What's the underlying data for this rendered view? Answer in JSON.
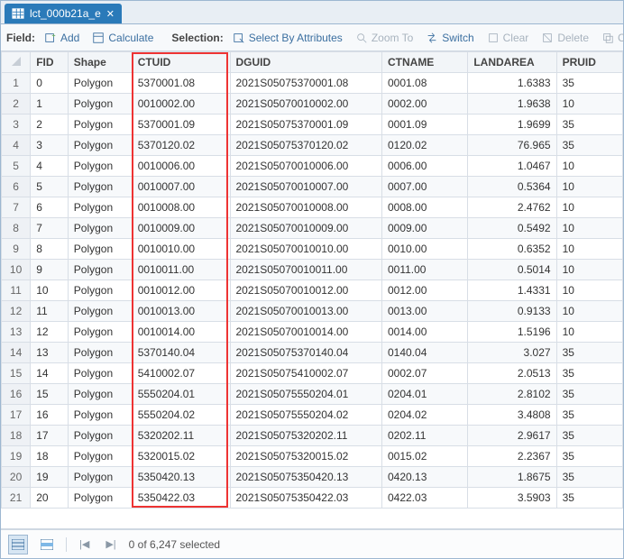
{
  "tab": {
    "title": "lct_000b21a_e",
    "icon": "table-icon"
  },
  "toolbar": {
    "field_label": "Field:",
    "add": "Add",
    "calculate": "Calculate",
    "selection_label": "Selection:",
    "select_by_attrs": "Select By Attributes",
    "zoom_to": "Zoom To",
    "switch": "Switch",
    "clear": "Clear",
    "delete": "Delete",
    "copy": "Copy"
  },
  "columns": [
    "FID",
    "Shape",
    "CTUID",
    "DGUID",
    "CTNAME",
    "LANDAREA",
    "PRUID"
  ],
  "highlight_column": "CTUID",
  "rows": [
    {
      "n": 1,
      "fid": 0,
      "shape": "Polygon",
      "ctuid": "5370001.08",
      "dguid": "2021S05075370001.08",
      "ctname": "0001.08",
      "landarea": "1.6383",
      "pruid": "35"
    },
    {
      "n": 2,
      "fid": 1,
      "shape": "Polygon",
      "ctuid": "0010002.00",
      "dguid": "2021S05070010002.00",
      "ctname": "0002.00",
      "landarea": "1.9638",
      "pruid": "10"
    },
    {
      "n": 3,
      "fid": 2,
      "shape": "Polygon",
      "ctuid": "5370001.09",
      "dguid": "2021S05075370001.09",
      "ctname": "0001.09",
      "landarea": "1.9699",
      "pruid": "35"
    },
    {
      "n": 4,
      "fid": 3,
      "shape": "Polygon",
      "ctuid": "5370120.02",
      "dguid": "2021S05075370120.02",
      "ctname": "0120.02",
      "landarea": "76.965",
      "pruid": "35"
    },
    {
      "n": 5,
      "fid": 4,
      "shape": "Polygon",
      "ctuid": "0010006.00",
      "dguid": "2021S05070010006.00",
      "ctname": "0006.00",
      "landarea": "1.0467",
      "pruid": "10"
    },
    {
      "n": 6,
      "fid": 5,
      "shape": "Polygon",
      "ctuid": "0010007.00",
      "dguid": "2021S05070010007.00",
      "ctname": "0007.00",
      "landarea": "0.5364",
      "pruid": "10"
    },
    {
      "n": 7,
      "fid": 6,
      "shape": "Polygon",
      "ctuid": "0010008.00",
      "dguid": "2021S05070010008.00",
      "ctname": "0008.00",
      "landarea": "2.4762",
      "pruid": "10"
    },
    {
      "n": 8,
      "fid": 7,
      "shape": "Polygon",
      "ctuid": "0010009.00",
      "dguid": "2021S05070010009.00",
      "ctname": "0009.00",
      "landarea": "0.5492",
      "pruid": "10"
    },
    {
      "n": 9,
      "fid": 8,
      "shape": "Polygon",
      "ctuid": "0010010.00",
      "dguid": "2021S05070010010.00",
      "ctname": "0010.00",
      "landarea": "0.6352",
      "pruid": "10"
    },
    {
      "n": 10,
      "fid": 9,
      "shape": "Polygon",
      "ctuid": "0010011.00",
      "dguid": "2021S05070010011.00",
      "ctname": "0011.00",
      "landarea": "0.5014",
      "pruid": "10"
    },
    {
      "n": 11,
      "fid": 10,
      "shape": "Polygon",
      "ctuid": "0010012.00",
      "dguid": "2021S05070010012.00",
      "ctname": "0012.00",
      "landarea": "1.4331",
      "pruid": "10"
    },
    {
      "n": 12,
      "fid": 11,
      "shape": "Polygon",
      "ctuid": "0010013.00",
      "dguid": "2021S05070010013.00",
      "ctname": "0013.00",
      "landarea": "0.9133",
      "pruid": "10"
    },
    {
      "n": 13,
      "fid": 12,
      "shape": "Polygon",
      "ctuid": "0010014.00",
      "dguid": "2021S05070010014.00",
      "ctname": "0014.00",
      "landarea": "1.5196",
      "pruid": "10"
    },
    {
      "n": 14,
      "fid": 13,
      "shape": "Polygon",
      "ctuid": "5370140.04",
      "dguid": "2021S05075370140.04",
      "ctname": "0140.04",
      "landarea": "3.027",
      "pruid": "35"
    },
    {
      "n": 15,
      "fid": 14,
      "shape": "Polygon",
      "ctuid": "5410002.07",
      "dguid": "2021S05075410002.07",
      "ctname": "0002.07",
      "landarea": "2.0513",
      "pruid": "35"
    },
    {
      "n": 16,
      "fid": 15,
      "shape": "Polygon",
      "ctuid": "5550204.01",
      "dguid": "2021S05075550204.01",
      "ctname": "0204.01",
      "landarea": "2.8102",
      "pruid": "35"
    },
    {
      "n": 17,
      "fid": 16,
      "shape": "Polygon",
      "ctuid": "5550204.02",
      "dguid": "2021S05075550204.02",
      "ctname": "0204.02",
      "landarea": "3.4808",
      "pruid": "35"
    },
    {
      "n": 18,
      "fid": 17,
      "shape": "Polygon",
      "ctuid": "5320202.11",
      "dguid": "2021S05075320202.11",
      "ctname": "0202.11",
      "landarea": "2.9617",
      "pruid": "35"
    },
    {
      "n": 19,
      "fid": 18,
      "shape": "Polygon",
      "ctuid": "5320015.02",
      "dguid": "2021S05075320015.02",
      "ctname": "0015.02",
      "landarea": "2.2367",
      "pruid": "35"
    },
    {
      "n": 20,
      "fid": 19,
      "shape": "Polygon",
      "ctuid": "5350420.13",
      "dguid": "2021S05075350420.13",
      "ctname": "0420.13",
      "landarea": "1.8675",
      "pruid": "35"
    },
    {
      "n": 21,
      "fid": 20,
      "shape": "Polygon",
      "ctuid": "5350422.03",
      "dguid": "2021S05075350422.03",
      "ctname": "0422.03",
      "landarea": "3.5903",
      "pruid": "35"
    }
  ],
  "status": {
    "selected_text": "0 of 6,247 selected"
  }
}
